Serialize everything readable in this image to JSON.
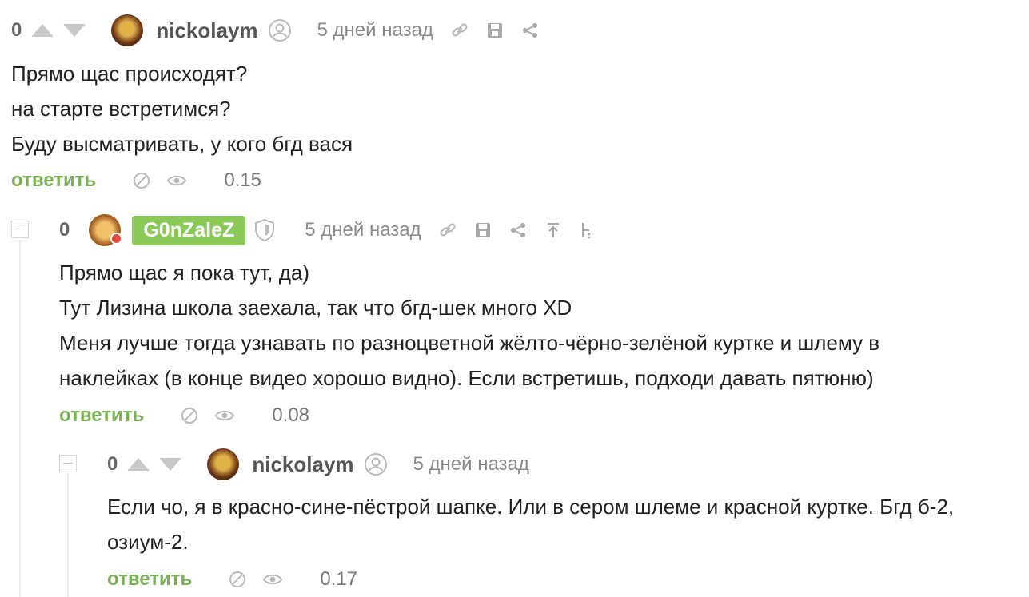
{
  "comments": [
    {
      "score": "0",
      "username": "nickolaym",
      "date": "5 дней назад",
      "lines": [
        "Прямо щас происходят?",
        "на старте встретимся?",
        "Буду высматривать, у кого бгд вася"
      ],
      "reply_label": "ответить",
      "rating": "0.15",
      "icons": [
        "arrow-up-icon",
        "arrow-down-icon",
        "user-icon",
        "link-icon",
        "save-icon",
        "share-icon",
        "block-icon",
        "eye-icon"
      ]
    },
    {
      "score": "0",
      "username": "G0nZaleZ",
      "date": "5 дней назад",
      "lines": [
        "Прямо щас я пока тут, да)",
        "Тут Лизина школа заехала, так что бгд-шек много XD",
        "Меня лучше тогда узнавать по разноцветной жёлто-чёрно-зелёной куртке и шлему в",
        "наклейках (в конце видео хорошо видно). Если встретишь, подходи давать пятюню)"
      ],
      "reply_label": "ответить",
      "rating": "0.08",
      "icons": [
        "collapse-icon",
        "shield-icon",
        "link-icon",
        "save-icon",
        "share-icon",
        "scroll-top-icon",
        "tree-icon",
        "block-icon",
        "eye-icon"
      ]
    },
    {
      "score": "0",
      "username": "nickolaym",
      "date": "5 дней назад",
      "lines": [
        "Если чо, я в красно-сине-пёстрой шапке. Или в сером шлеме и красной куртке. Бгд б-2,",
        "озиум-2."
      ],
      "reply_label": "ответить",
      "rating": "0.17",
      "icons": [
        "collapse-icon",
        "arrow-up-icon",
        "arrow-down-icon",
        "user-icon",
        "block-icon",
        "eye-icon"
      ]
    }
  ],
  "colors": {
    "accent_green": "#7ab055",
    "badge_green": "#8ac858",
    "muted": "#8a8a8a",
    "online_dot": "#e54b3c"
  }
}
